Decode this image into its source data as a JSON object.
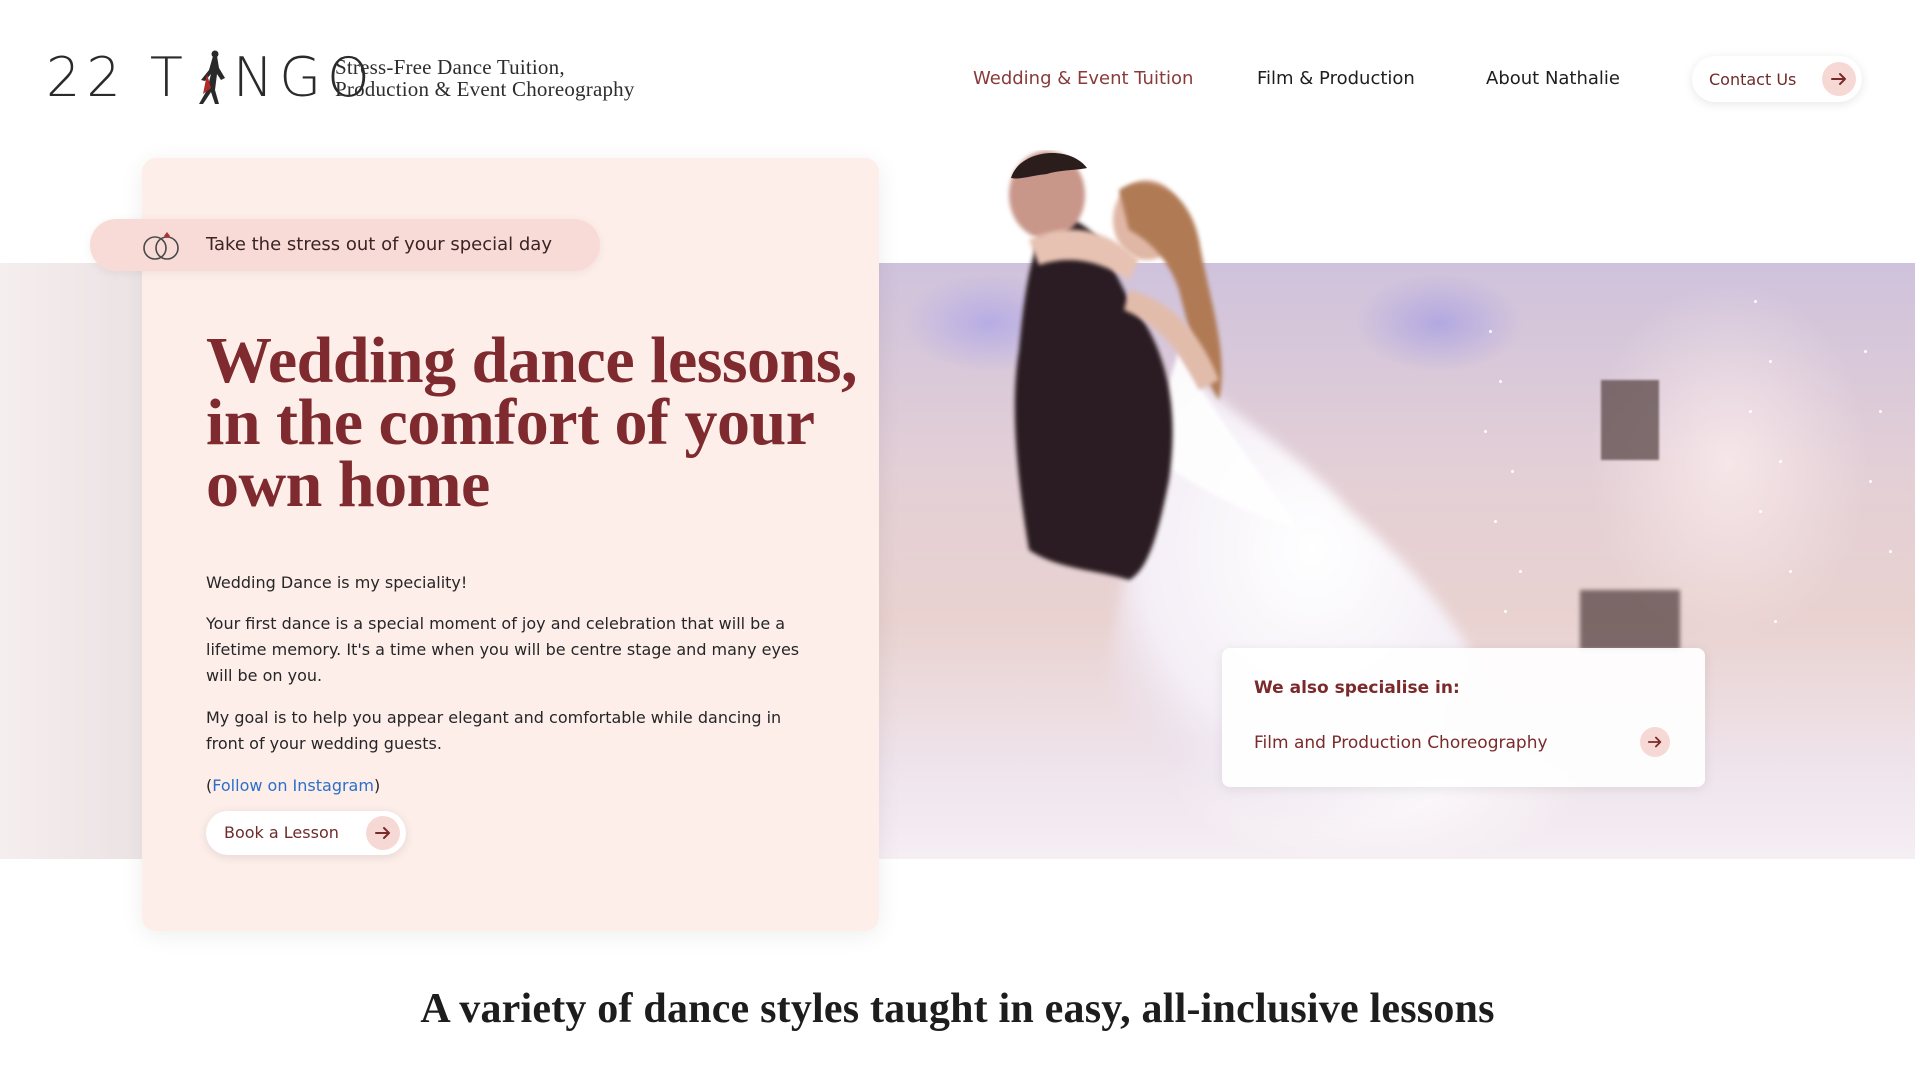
{
  "header": {
    "logo_text_left": "22 T",
    "logo_text_right": "NGO",
    "tagline_line1": "Stress-Free Dance Tuition,",
    "tagline_line2": "Production & Event Choreography"
  },
  "nav": {
    "items": [
      {
        "label": "Wedding & Event Tuition",
        "active": true
      },
      {
        "label": "Film & Production",
        "active": false
      },
      {
        "label": "About Nathalie",
        "active": false
      }
    ],
    "contact_label": "Contact Us"
  },
  "hero": {
    "pill_text": "Take the stress out of your special day",
    "title_lines": [
      "Wedding dance lessons,",
      "in the comfort of  your",
      "own home"
    ],
    "paragraph1": "Wedding Dance is my speciality!",
    "paragraph2": "Your first dance is a special moment of joy and celebration that will be a lifetime memory. It's a time when you will be centre stage and many eyes will be on you.",
    "paragraph3": "My goal is to help you appear elegant and comfortable while dancing in front of your wedding guests.",
    "instagram_open": "(",
    "instagram_link": "Follow on Instagram",
    "instagram_close": ")",
    "book_label": "Book a Lesson"
  },
  "specialise": {
    "heading": "We also specialise in:",
    "item": "Film and Production Choreography"
  },
  "section": {
    "title": "A variety of dance styles taught in easy, all-inclusive lessons"
  },
  "colors": {
    "accent": "#7e2a2e",
    "card_bg": "#fdeeea",
    "pill_bg": "#f8dbd6",
    "arrow_bg": "#f6d9d4",
    "link": "#2b6fc9"
  },
  "icons": [
    "dancer-logo-icon",
    "wedding-rings-icon",
    "arrow-right-icon"
  ]
}
